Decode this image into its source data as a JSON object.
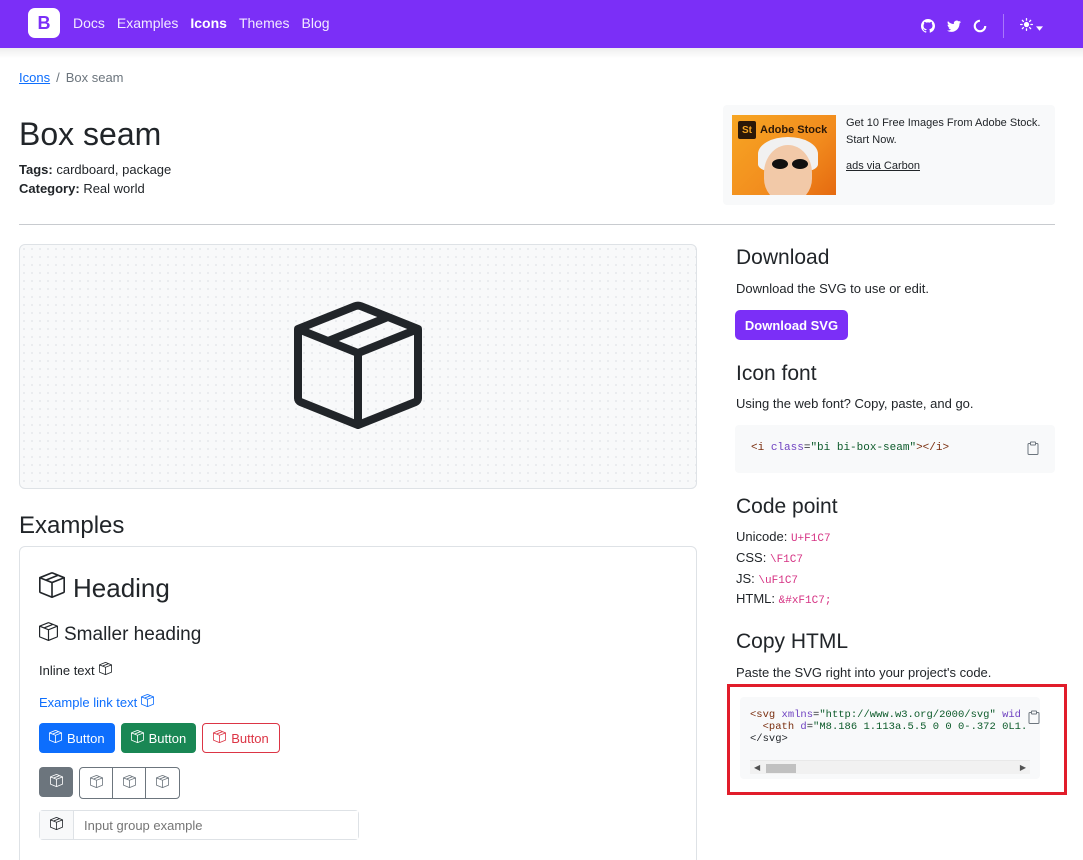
{
  "nav": {
    "brand": "B",
    "links": [
      "Docs",
      "Examples",
      "Icons",
      "Themes",
      "Blog"
    ],
    "active": "Icons",
    "icons": [
      "github-icon",
      "twitter-icon",
      "opencollective-icon",
      "sun-icon",
      "caret-down-icon"
    ]
  },
  "breadcrumb": {
    "parent": "Icons",
    "separator": "/",
    "current": "Box seam"
  },
  "title": "Box seam",
  "meta": {
    "tags_label": "Tags:",
    "tags_value": "cardboard, package",
    "category_label": "Category:",
    "category_value": "Real world"
  },
  "ad": {
    "logo_mark": "St",
    "logo_text": "Adobe Stock",
    "text": "Get 10 Free Images From Adobe Stock. Start Now.",
    "via": "ads via Carbon"
  },
  "examples": {
    "title": "Examples",
    "heading": "Heading",
    "smaller_heading": "Smaller heading",
    "inline_text": "Inline text",
    "link_text": "Example link text",
    "buttons": [
      "Button",
      "Button",
      "Button"
    ],
    "input_placeholder": "Input group example"
  },
  "download": {
    "title": "Download",
    "desc": "Download the SVG to use or edit.",
    "button": "Download SVG"
  },
  "icon_font": {
    "title": "Icon font",
    "desc": "Using the web font? Copy, paste, and go.",
    "code_open": "<i ",
    "code_attr": "class",
    "code_eq": "=",
    "code_value": "\"bi bi-box-seam\"",
    "code_close": "></i>"
  },
  "code_point": {
    "title": "Code point",
    "unicode_label": "Unicode:",
    "unicode_value": "U+F1C7",
    "css_label": "CSS:",
    "css_value": "\\F1C7",
    "js_label": "JS:",
    "js_value": "\\uF1C7",
    "html_label": "HTML:",
    "html_value": "&#xF1C7;"
  },
  "copy_html": {
    "title": "Copy HTML",
    "desc": "Paste the SVG right into your project's code.",
    "line1_tag": "<svg ",
    "line1_attr": "xmlns",
    "line1_eq": "=",
    "line1_val": "\"http://www.w3.org/2000/svg\"",
    "line1_rest": " wid",
    "line2_indent": "  ",
    "line2_tag": "<path ",
    "line2_attr": "d",
    "line2_eq": "=",
    "line2_val": "\"M8.186 1.113a.5.5 0 0 0-.372 0L1.",
    "line3": "</svg>"
  },
  "colors": {
    "brand": "#7b2ff7",
    "highlight": "#e11d2a"
  }
}
